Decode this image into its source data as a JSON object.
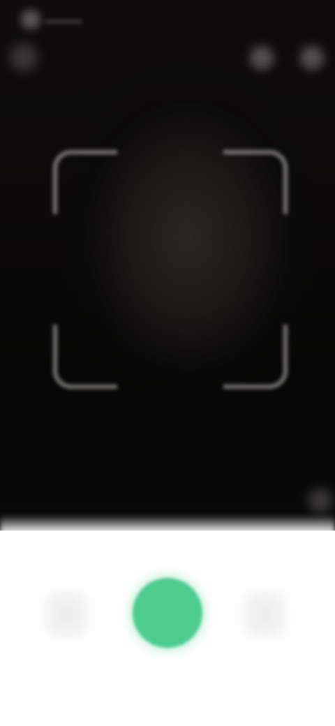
{
  "screen": {
    "mode": "scan-camera"
  },
  "status_bar": {
    "icons": [
      "signal-icon",
      "wifi-icon"
    ]
  },
  "top_bar": {
    "back_icon": "back-arrow-icon",
    "actions": [
      "flash-icon",
      "more-icon"
    ]
  },
  "viewfinder": {
    "frame_icon": "scan-frame-icon",
    "side_icon": "zoom-icon"
  },
  "controls": {
    "left_icon": "gallery-icon",
    "shutter_color": "#4CCD8E",
    "right_icon": "switch-camera-icon"
  }
}
